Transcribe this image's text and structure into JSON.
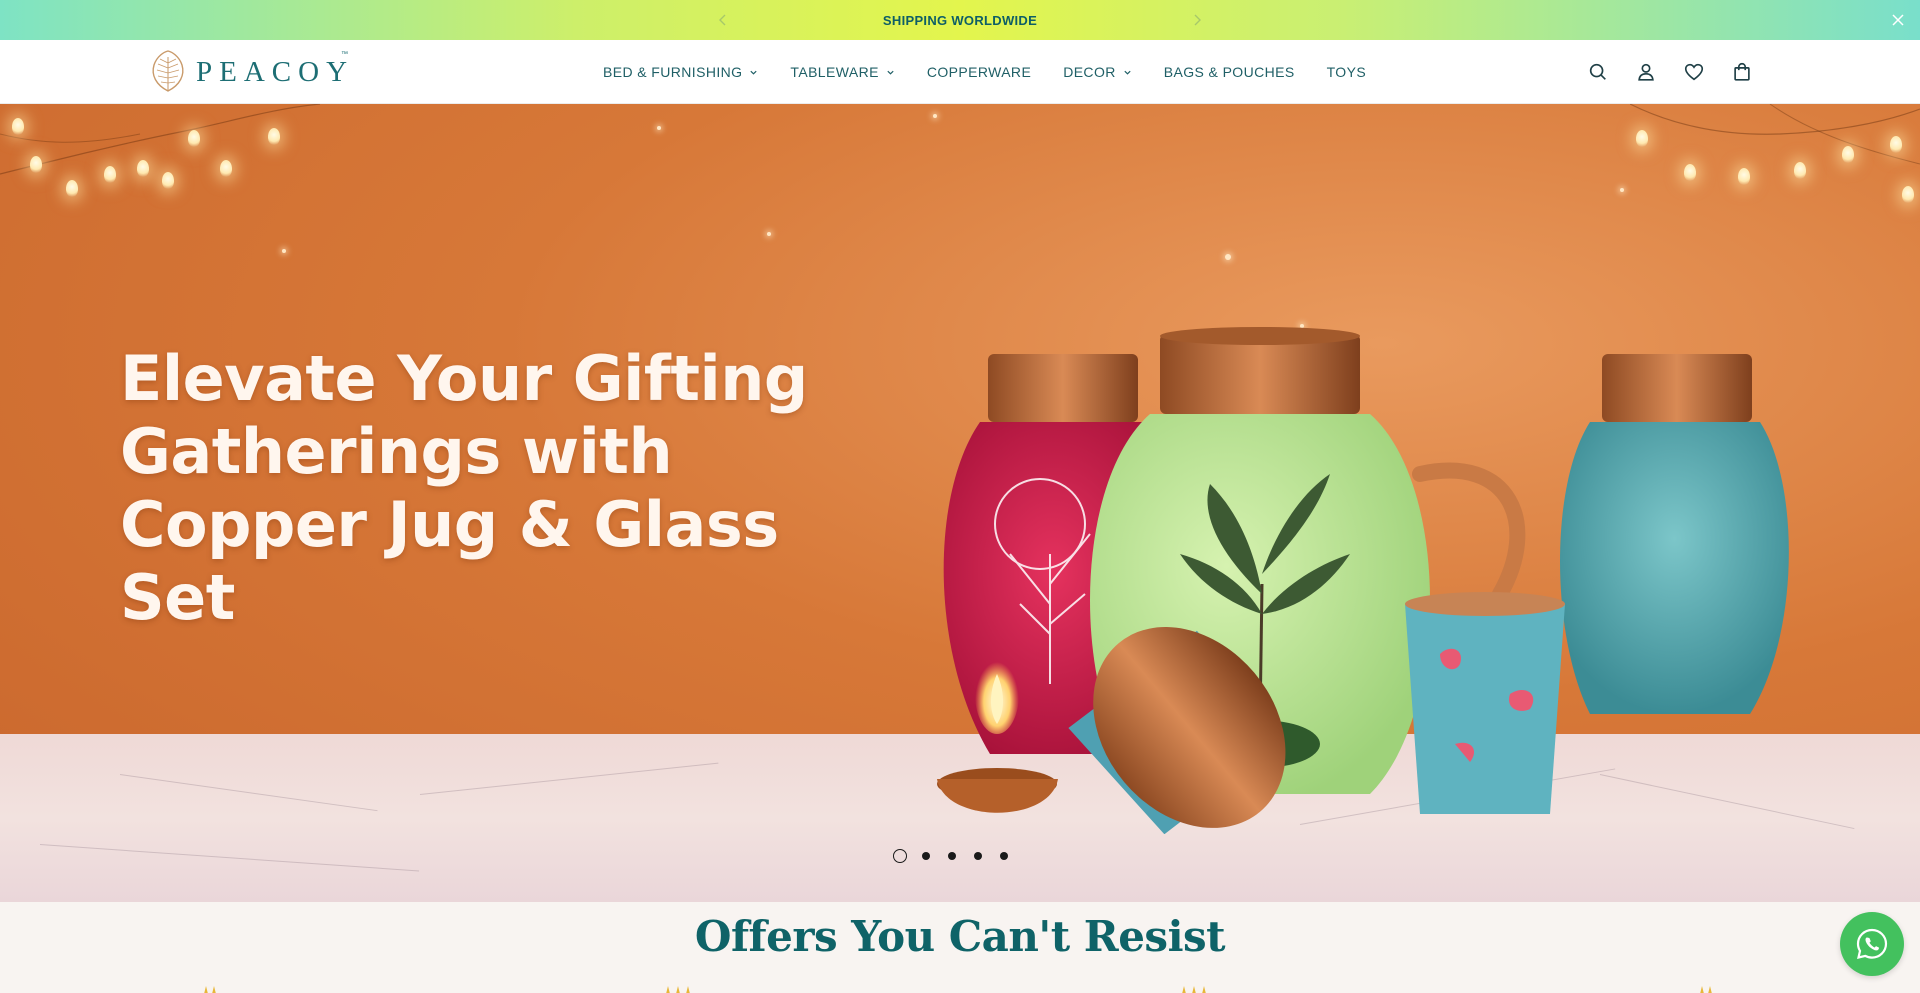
{
  "announcement": {
    "text": "SHIPPING WORLDWIDE"
  },
  "header": {
    "logo_text": "PEACOY",
    "logo_tm": "™",
    "nav": [
      {
        "label": "BED & FURNISHING",
        "has_dropdown": true
      },
      {
        "label": "TABLEWARE",
        "has_dropdown": true
      },
      {
        "label": "COPPERWARE",
        "has_dropdown": false
      },
      {
        "label": "DECOR",
        "has_dropdown": true
      },
      {
        "label": "BAGS & POUCHES",
        "has_dropdown": false
      },
      {
        "label": "TOYS",
        "has_dropdown": false
      }
    ],
    "icons": [
      "search-icon",
      "account-icon",
      "wishlist-heart-icon",
      "cart-bag-icon"
    ]
  },
  "hero": {
    "title": "Elevate Your Gifting Gatherings with Copper Jug & Glass Set",
    "slide_count": 5,
    "active_slide": 1
  },
  "offers": {
    "title": "Offers You Can't Resist"
  },
  "colors": {
    "brand_teal": "#1d6e74",
    "announce_text": "#0e5e66",
    "hero_orange": "#d77838",
    "whatsapp_green": "#43c15e"
  }
}
